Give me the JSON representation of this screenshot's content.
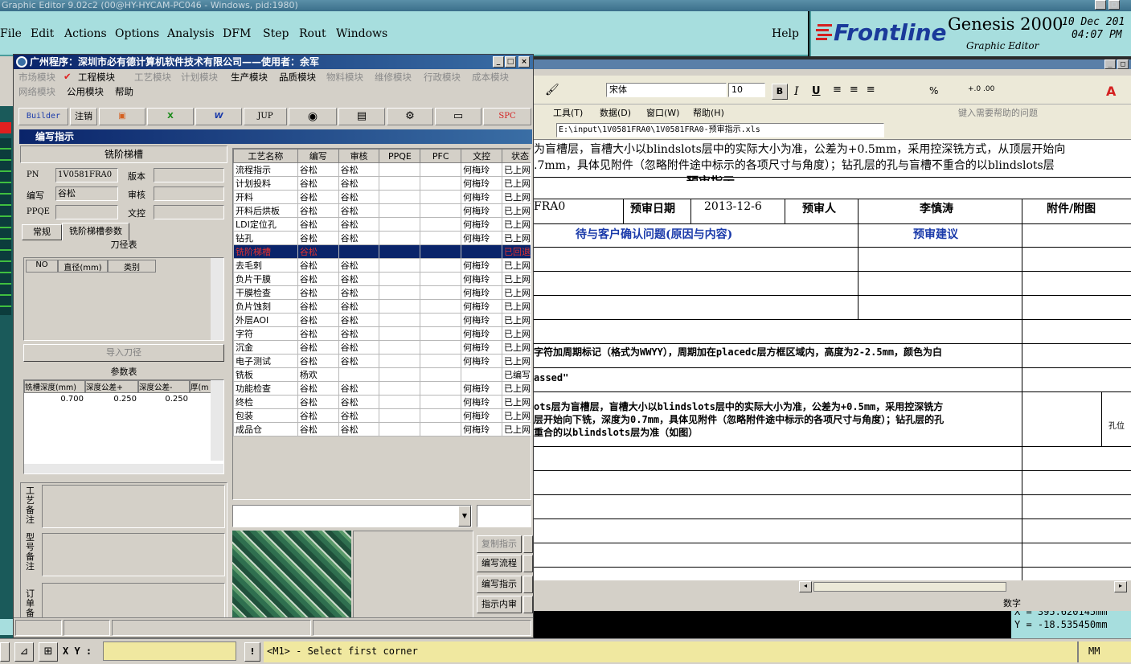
{
  "titlebar": {
    "text": "Graphic Editor 9.02c2 (00@HY-HYCAM-PC046 - Windows, pid:1980)"
  },
  "menu": {
    "items": [
      "File",
      "Edit",
      "Actions",
      "Options",
      "Analysis",
      "DFM",
      "Step",
      "Rout",
      "Windows"
    ],
    "help": "Help"
  },
  "brand": {
    "logo": "Frontline",
    "product": "Genesis 2000",
    "subtitle": "Graphic Editor",
    "date": "10 Dec 201",
    "time": "04:07 PM"
  },
  "dialog": {
    "title": "广州程序：深圳市必有德计算机软件技术有限公司——使用者：余军",
    "modules_row1": [
      "市场模块",
      "工程模块",
      "工艺模块",
      "计划模块",
      "生产模块",
      "品质模块",
      "物料模块",
      "维修模块",
      "行政模块",
      "成本模块"
    ],
    "modules_row2": [
      "网络模块",
      "公用模块",
      "帮助"
    ],
    "toolbar": [
      "Builder",
      "注销",
      "JUP",
      "SPC"
    ],
    "sub_title": "编写指示",
    "left": {
      "heading": "铣阶梯槽",
      "pn_label": "PN",
      "pn_value": "1V0581FRA0",
      "version_label": "版本",
      "author_label": "编写",
      "author_value": "谷松",
      "review_label": "审核",
      "ppqe_label": "PPQE",
      "doc_label": "文控",
      "tabs": [
        "常规",
        "铣阶梯槽参数"
      ],
      "tool_table_title": "刀径表",
      "tool_cols": [
        "NO",
        "直径(mm)",
        "类别"
      ],
      "import_btn": "导入刀径",
      "param_title": "参数表",
      "param_cols": [
        "铣槽深度(mm)",
        "深度公差+",
        "深度公差-",
        "厚(m"
      ],
      "param_values": [
        "0.700",
        "0.250",
        "0.250"
      ],
      "note1": "工艺备注",
      "note2": "型号备注",
      "note3": "订单备"
    },
    "grid": {
      "cols": [
        "工艺名称",
        "编写",
        "审核",
        "PPQE",
        "PFC",
        "文控",
        "状态"
      ],
      "rows": [
        [
          "流程指示",
          "谷松",
          "谷松",
          "",
          "",
          "何梅玲",
          "已上网"
        ],
        [
          "计划投料",
          "谷松",
          "谷松",
          "",
          "",
          "何梅玲",
          "已上网"
        ],
        [
          "开料",
          "谷松",
          "谷松",
          "",
          "",
          "何梅玲",
          "已上网"
        ],
        [
          "开料后烘板",
          "谷松",
          "谷松",
          "",
          "",
          "何梅玲",
          "已上网"
        ],
        [
          "LDI定位孔",
          "谷松",
          "谷松",
          "",
          "",
          "何梅玲",
          "已上网"
        ],
        [
          "钻孔",
          "谷松",
          "谷松",
          "",
          "",
          "何梅玲",
          "已上网"
        ],
        [
          "铣阶梯槽",
          "谷松",
          "",
          "",
          "",
          "",
          "已回退"
        ],
        [
          "去毛刺",
          "谷松",
          "谷松",
          "",
          "",
          "何梅玲",
          "已上网"
        ],
        [
          "负片干膜",
          "谷松",
          "谷松",
          "",
          "",
          "何梅玲",
          "已上网"
        ],
        [
          "干膜检查",
          "谷松",
          "谷松",
          "",
          "",
          "何梅玲",
          "已上网"
        ],
        [
          "负片蚀刻",
          "谷松",
          "谷松",
          "",
          "",
          "何梅玲",
          "已上网"
        ],
        [
          "外层AOI",
          "谷松",
          "谷松",
          "",
          "",
          "何梅玲",
          "已上网"
        ],
        [
          "字符",
          "谷松",
          "谷松",
          "",
          "",
          "何梅玲",
          "已上网"
        ],
        [
          "沉金",
          "谷松",
          "谷松",
          "",
          "",
          "何梅玲",
          "已上网"
        ],
        [
          "电子测试",
          "谷松",
          "谷松",
          "",
          "",
          "何梅玲",
          "已上网"
        ],
        [
          "铣板",
          "杨欢",
          "",
          "",
          "",
          "",
          "已编写"
        ],
        [
          "功能检查",
          "谷松",
          "谷松",
          "",
          "",
          "何梅玲",
          "已上网"
        ],
        [
          "终检",
          "谷松",
          "谷松",
          "",
          "",
          "何梅玲",
          "已上网"
        ],
        [
          "包装",
          "谷松",
          "谷松",
          "",
          "",
          "何梅玲",
          "已上网"
        ],
        [
          "成品仓",
          "谷松",
          "谷松",
          "",
          "",
          "何梅玲",
          "已上网"
        ]
      ],
      "selected_index": 6
    },
    "side_buttons": [
      "复制指示",
      "编写流程",
      "编写指示",
      "指示内审"
    ]
  },
  "excel": {
    "font": "宋体",
    "size": "10",
    "menu": [
      "工具(T)",
      "数据(D)",
      "窗口(W)",
      "帮助(H)"
    ],
    "help_placeholder": "键入需要帮助的问题",
    "path": "E:\\input\\1V0581FRA0\\1V0581FRA0-预审指示.xls",
    "formula_line1": "为盲槽层，盲槽大小以blindslots层中的实际大小为准，公差为+0.5mm，采用控深铣方式，从顶层开始向",
    ".formula_line2": "",
    "formula_line2": ".7mm，具体见附件（忽略附件途中标示的各项尺寸与角度）；钻孔层的孔与盲槽不重合的以blindslots层",
    "sheet_title": "预审指示",
    "hdr_pn": "FRA0",
    "hdr_date_label": "预审日期",
    "hdr_date": "2013-12-6",
    "hdr_person_label": "预审人",
    "hdr_person": "李慎涛",
    "hdr_attach": "附件/附图",
    "col_issue": "待与客户确认问题(原因与内容)",
    "col_advice": "预审建议",
    "row_marking": "字符加周期标记（格式为WWYY），周期加在placedc层方框区域内，高度为2-2.5mm，颜色为白",
    "row_passed": "assed\"",
    "row_slot1": "ots层为盲槽层，盲槽大小以blindslots层中的实际大小为准，公差为+0.5mm，采用控深铣方",
    "row_slot2": "层开始向下铣，深度为0.7mm，具体见附件（忽略附件途中标示的各项尺寸与角度）；钻孔层的孔",
    "row_slot3": "重合的以blindslots层为准（如图）",
    "attach_note": "孔位",
    "status_num": "数字"
  },
  "coords": {
    "x": "X = 395.620145mm",
    "y": "Y = -18.535450mm"
  },
  "statusbar": {
    "xy_label": "X Y :",
    "prompt": "<M1> - Select first corner",
    "units": "MM"
  },
  "colors": {
    "teal": "#a7dede",
    "selection": "#0a246a",
    "brand_red": "#d42020",
    "brand_blue": "#1a3a9a"
  }
}
